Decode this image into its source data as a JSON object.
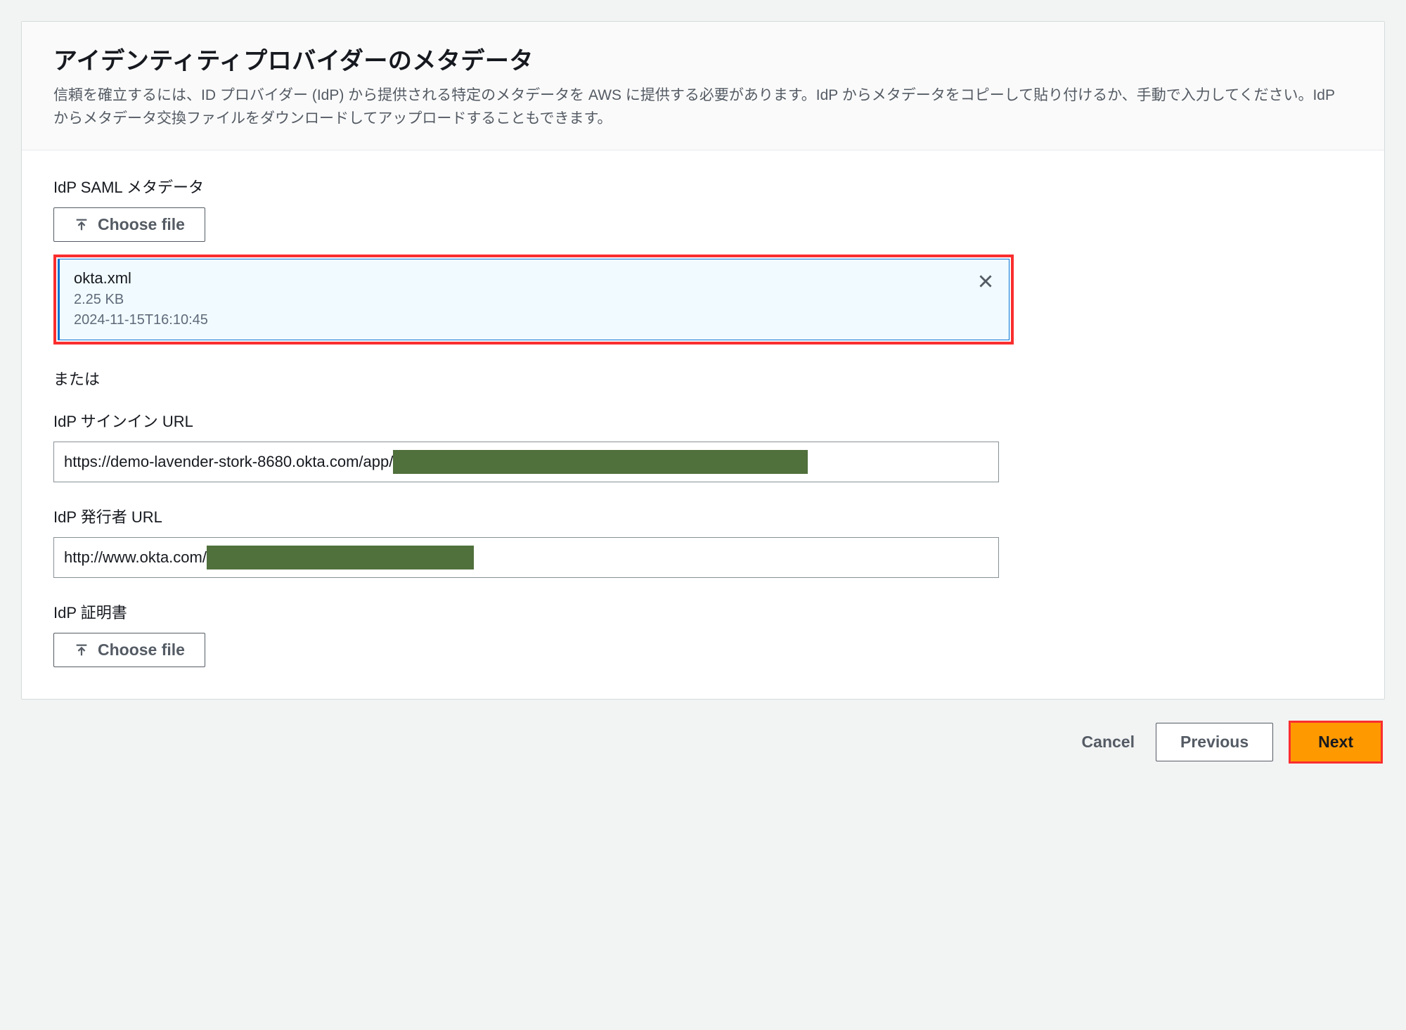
{
  "header": {
    "title": "アイデンティティプロバイダーのメタデータ",
    "description": "信頼を確立するには、ID プロバイダー (IdP) から提供される特定のメタデータを AWS に提供する必要があります。IdP からメタデータをコピーして貼り付けるか、手動で入力してください。IdP からメタデータ交換ファイルをダウンロードしてアップロードすることもできます。"
  },
  "form": {
    "samlMetadataLabel": "IdP SAML メタデータ",
    "chooseFileLabel": "Choose file",
    "uploadedFile": {
      "name": "okta.xml",
      "size": "2.25 KB",
      "timestamp": "2024-11-15T16:10:45"
    },
    "orLabel": "または",
    "signInUrlLabel": "IdP サインイン URL",
    "signInUrlVisible": "https://demo-lavender-stork-8680.okta.com/app/",
    "issuerUrlLabel": "IdP 発行者 URL",
    "issuerUrlVisible": "http://www.okta.com/",
    "certificateLabel": "IdP 証明書"
  },
  "footer": {
    "cancel": "Cancel",
    "previous": "Previous",
    "next": "Next"
  }
}
